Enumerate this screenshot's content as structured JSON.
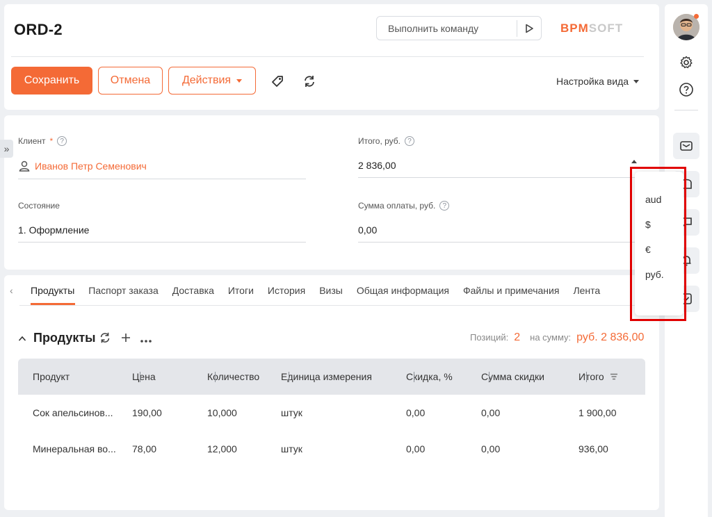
{
  "header": {
    "title": "ORD-2",
    "command_placeholder": "Выполнить команду",
    "logo_part1": "BPM",
    "logo_part2": "SOFT",
    "buttons": {
      "save": "Сохранить",
      "cancel": "Отмена",
      "actions": "Действия"
    },
    "view_settings": "Настройка вида"
  },
  "fields": {
    "client_label": "Клиент",
    "client_required": "*",
    "client_value": "Иванов Петр Семенович",
    "total_label": "Итого, руб.",
    "total_value": "2 836,00",
    "state_label": "Состояние",
    "state_value": "1. Оформление",
    "payment_label": "Сумма оплаты, руб.",
    "payment_value": "0,00",
    "help": "?"
  },
  "tabs": [
    "Продукты",
    "Паспорт заказа",
    "Доставка",
    "Итоги",
    "История",
    "Визы",
    "Общая информация",
    "Файлы и примечания",
    "Лента"
  ],
  "products": {
    "title": "Продукты",
    "positions_label": "Позиций:",
    "positions_value": "2",
    "sum_label": "на сумму:",
    "sum_value": "руб.  2 836,00",
    "columns": [
      "Продукт",
      "Цена",
      "Количество",
      "Единица измерения",
      "Скидка, %",
      "Сумма скидки",
      "Итого"
    ],
    "rows": [
      [
        "Сок апельсинов...",
        "190,00",
        "10,000",
        "штук",
        "0,00",
        "0,00",
        "1 900,00"
      ],
      [
        "Минеральная во...",
        "78,00",
        "12,000",
        "штук",
        "0,00",
        "0,00",
        "936,00"
      ]
    ]
  },
  "currency_dropdown": {
    "options": [
      "aud",
      "$",
      "€",
      "руб."
    ]
  },
  "colors": {
    "accent": "#f46a36",
    "highlight": "#e10000"
  }
}
